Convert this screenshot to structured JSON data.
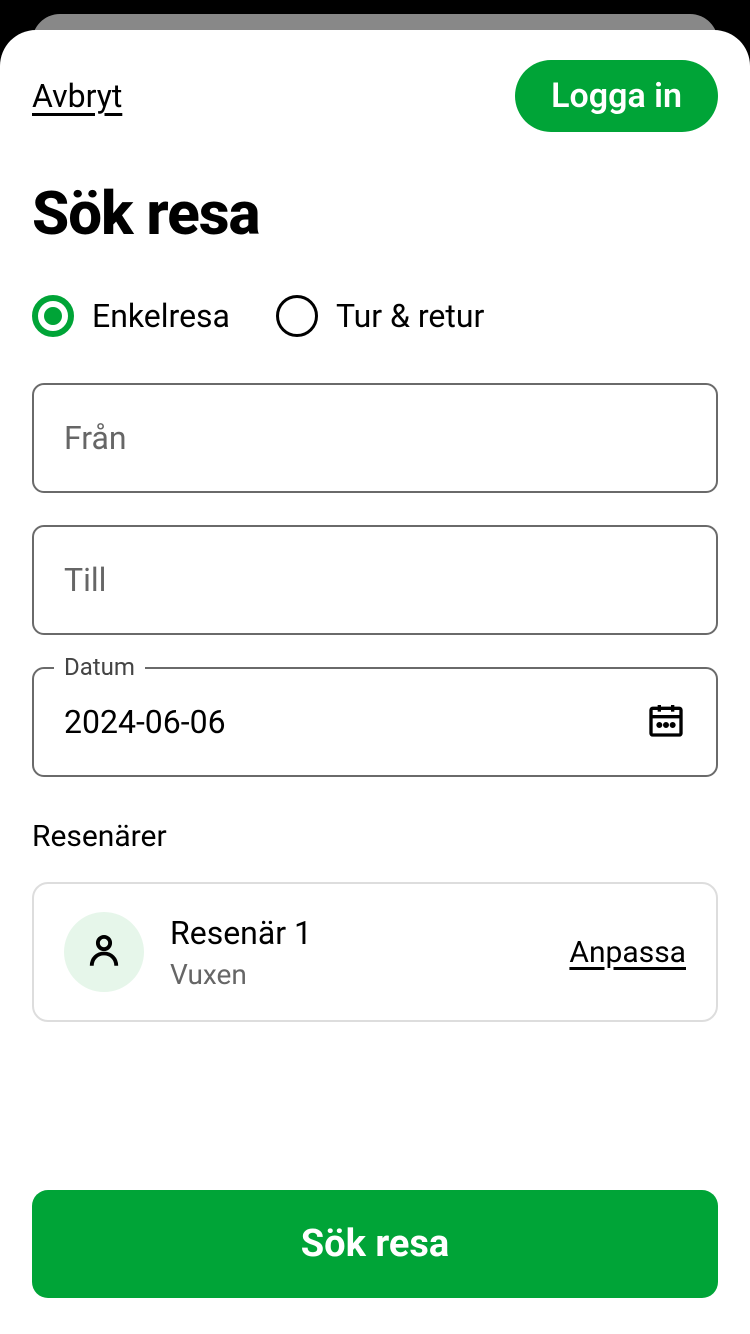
{
  "header": {
    "cancel_label": "Avbryt",
    "login_label": "Logga in"
  },
  "title": "Sök resa",
  "trip_type": {
    "one_way_label": "Enkelresa",
    "round_trip_label": "Tur & retur",
    "selected": "one_way"
  },
  "fields": {
    "from_placeholder": "Från",
    "from_value": "",
    "to_placeholder": "Till",
    "to_value": "",
    "date_label": "Datum",
    "date_value": "2024-06-06"
  },
  "travellers": {
    "section_label": "Resenärer",
    "item": {
      "title": "Resenär 1",
      "subtitle": "Vuxen"
    },
    "customize_label": "Anpassa"
  },
  "search_button_label": "Sök resa",
  "colors": {
    "accent": "#00a437"
  }
}
